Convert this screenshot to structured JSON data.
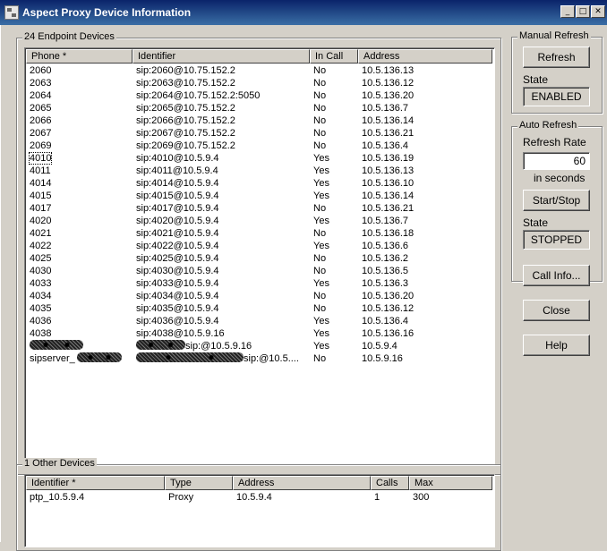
{
  "window": {
    "title": "Aspect Proxy Device Information",
    "icon": "app-window-icon",
    "minimize_glyph": "_",
    "maximize_glyph": "□",
    "close_glyph": "✕"
  },
  "endpoints": {
    "group_title": "24 Endpoint Devices",
    "columns": [
      "Phone *",
      "Identifier",
      "In Call",
      "Address"
    ],
    "rows": [
      {
        "phone": "2060",
        "identifier": "sip:2060@10.75.152.2",
        "in_call": "No",
        "address": "10.5.136.13"
      },
      {
        "phone": "2063",
        "identifier": "sip:2063@10.75.152.2",
        "in_call": "No",
        "address": "10.5.136.12"
      },
      {
        "phone": "2064",
        "identifier": "sip:2064@10.75.152.2:5050",
        "in_call": "No",
        "address": "10.5.136.20"
      },
      {
        "phone": "2065",
        "identifier": "sip:2065@10.75.152.2",
        "in_call": "No",
        "address": "10.5.136.7"
      },
      {
        "phone": "2066",
        "identifier": "sip:2066@10.75.152.2",
        "in_call": "No",
        "address": "10.5.136.14"
      },
      {
        "phone": "2067",
        "identifier": "sip:2067@10.75.152.2",
        "in_call": "No",
        "address": "10.5.136.21"
      },
      {
        "phone": "2069",
        "identifier": "sip:2069@10.75.152.2",
        "in_call": "No",
        "address": "10.5.136.4"
      },
      {
        "phone": "4010",
        "identifier": "sip:4010@10.5.9.4",
        "in_call": "Yes",
        "address": "10.5.136.19"
      },
      {
        "phone": "4011",
        "identifier": "sip:4011@10.5.9.4",
        "in_call": "Yes",
        "address": "10.5.136.13"
      },
      {
        "phone": "4014",
        "identifier": "sip:4014@10.5.9.4",
        "in_call": "Yes",
        "address": "10.5.136.10"
      },
      {
        "phone": "4015",
        "identifier": "sip:4015@10.5.9.4",
        "in_call": "Yes",
        "address": "10.5.136.14"
      },
      {
        "phone": "4017",
        "identifier": "sip:4017@10.5.9.4",
        "in_call": "No",
        "address": "10.5.136.21"
      },
      {
        "phone": "4020",
        "identifier": "sip:4020@10.5.9.4",
        "in_call": "Yes",
        "address": "10.5.136.7"
      },
      {
        "phone": "4021",
        "identifier": "sip:4021@10.5.9.4",
        "in_call": "No",
        "address": "10.5.136.18"
      },
      {
        "phone": "4022",
        "identifier": "sip:4022@10.5.9.4",
        "in_call": "Yes",
        "address": "10.5.136.6"
      },
      {
        "phone": "4025",
        "identifier": "sip:4025@10.5.9.4",
        "in_call": "No",
        "address": "10.5.136.2"
      },
      {
        "phone": "4030",
        "identifier": "sip:4030@10.5.9.4",
        "in_call": "No",
        "address": "10.5.136.5"
      },
      {
        "phone": "4033",
        "identifier": "sip:4033@10.5.9.4",
        "in_call": "Yes",
        "address": "10.5.136.3"
      },
      {
        "phone": "4034",
        "identifier": "sip:4034@10.5.9.4",
        "in_call": "No",
        "address": "10.5.136.20"
      },
      {
        "phone": "4035",
        "identifier": "sip:4035@10.5.9.4",
        "in_call": "No",
        "address": "10.5.136.12"
      },
      {
        "phone": "4036",
        "identifier": "sip:4036@10.5.9.4",
        "in_call": "Yes",
        "address": "10.5.136.4"
      },
      {
        "phone": "4038",
        "identifier": "sip:4038@10.5.9.16",
        "in_call": "Yes",
        "address": "10.5.136.16"
      },
      {
        "phone": "",
        "identifier": "sip:@10.5.9.16",
        "in_call": "Yes",
        "address": "10.5.9.4"
      },
      {
        "phone": "sipserver_",
        "identifier": "sip:@10.5....",
        "in_call": "No",
        "address": "10.5.9.16"
      }
    ]
  },
  "others": {
    "group_title": "1 Other Devices",
    "columns": [
      "Identifier *",
      "Type",
      "Address",
      "Calls",
      "Max"
    ],
    "rows": [
      {
        "identifier": "ptp_10.5.9.4",
        "type": "Proxy",
        "address": "10.5.9.4",
        "calls": "1",
        "max": "300"
      }
    ]
  },
  "manual_refresh": {
    "group_title": "Manual Refresh",
    "refresh_label": "Refresh",
    "state_label": "State",
    "state_value": "ENABLED"
  },
  "auto_refresh": {
    "group_title": "Auto Refresh",
    "rate_label": "Refresh Rate",
    "rate_value": "60",
    "unit_label": "in seconds",
    "start_stop_label": "Start/Stop",
    "state_label": "State",
    "state_value": "STOPPED"
  },
  "actions": {
    "call_info_label": "Call Info...",
    "close_label": "Close",
    "help_label": "Help"
  }
}
